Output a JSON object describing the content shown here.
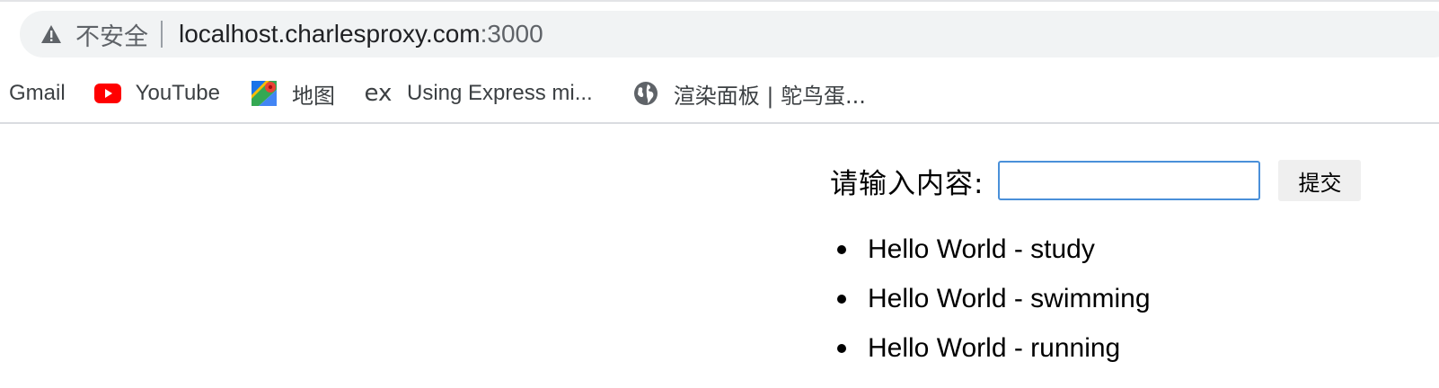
{
  "browser": {
    "security_label": "不安全",
    "url_host": "localhost.charlesproxy.com",
    "url_port": ":3000",
    "bookmarks": [
      {
        "label": "Gmail",
        "icon": "none"
      },
      {
        "label": "YouTube",
        "icon": "youtube-icon"
      },
      {
        "label": "地图",
        "icon": "maps-icon"
      },
      {
        "label": "Using Express mi...",
        "icon": "express-icon"
      },
      {
        "label": "渲染面板 | 鸵鸟蛋...",
        "icon": "globe-icon"
      }
    ]
  },
  "page": {
    "form": {
      "label": "请输入内容:",
      "input_value": "",
      "submit_label": "提交"
    },
    "items": [
      "Hello World - study",
      "Hello World - swimming",
      "Hello World - running"
    ]
  },
  "colors": {
    "omnibox_bg": "#f1f3f4",
    "input_border": "#4a90d9",
    "youtube_red": "#ff0000"
  }
}
